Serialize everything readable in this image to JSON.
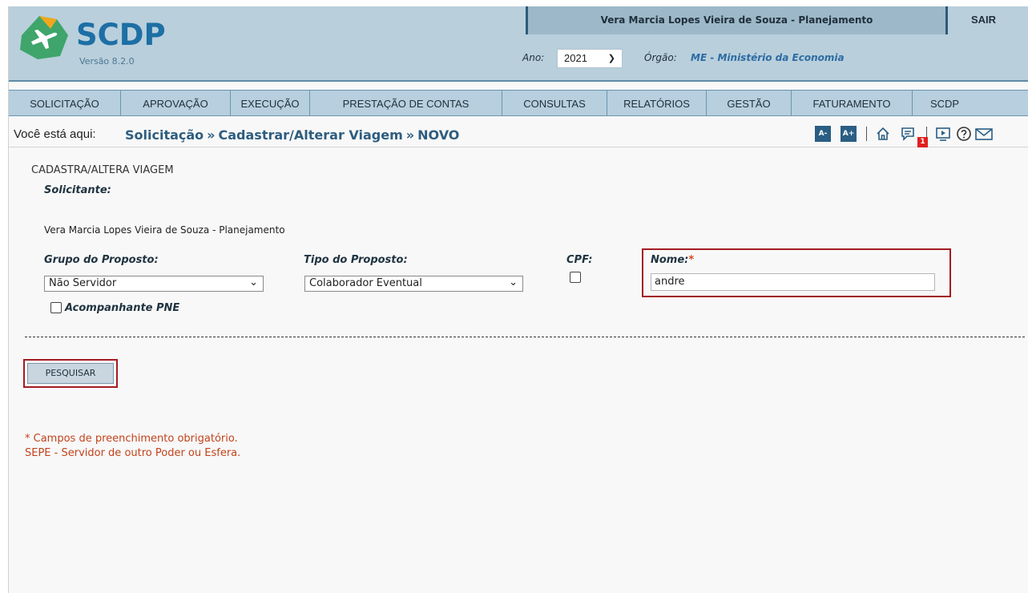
{
  "app": {
    "brand": "SCDP",
    "version": "Versão 8.2.0",
    "user": "Vera Marcia Lopes Vieira de Souza - Planejamento",
    "logout": "SAIR",
    "ano_label": "Ano:",
    "ano_value": "2021",
    "orgao_label": "Órgão:",
    "orgao_value": "ME - Ministério da Economia"
  },
  "menu": [
    {
      "label": "SOLICITAÇÃO"
    },
    {
      "label": "APROVAÇÃO"
    },
    {
      "label": "EXECUÇÃO"
    },
    {
      "label": "PRESTAÇÃO DE CONTAS"
    },
    {
      "label": "CONSULTAS"
    },
    {
      "label": "RELATÓRIOS"
    },
    {
      "label": "GESTÃO"
    },
    {
      "label": "FATURAMENTO"
    },
    {
      "label": "SCDP"
    }
  ],
  "breadcrumb": {
    "prefix": "Você está aqui:",
    "items": [
      "Solicitação",
      "Cadastrar/Alterar Viagem",
      "NOVO"
    ]
  },
  "toolbar": {
    "font_decrease": "A-",
    "font_increase": "A+",
    "messages_count": "1",
    "icons": [
      "home-icon",
      "messages-icon",
      "video-icon",
      "help-icon",
      "mail-icon"
    ]
  },
  "form": {
    "title": "CADASTRA/ALTERA VIAGEM",
    "solicitante_label": "Solicitante:",
    "solicitante_value": "Vera Marcia Lopes Vieira de Souza - Planejamento",
    "grupo_label": "Grupo do Proposto:",
    "grupo_value": "Não Servidor",
    "tipo_label": "Tipo do Proposto:",
    "tipo_value": "Colaborador Eventual",
    "cpf_label": "CPF:",
    "nome_label": "Nome:",
    "nome_required": "*",
    "nome_value": "andre",
    "acompanhante_label": "Acompanhante PNE",
    "search_button": "PESQUISAR"
  },
  "notes": {
    "required": "* Campos de preenchimento obrigatório.",
    "sepe": "SEPE - Servidor de outro Poder ou Esfera."
  },
  "colors": {
    "header_bg": "#b9cfdc",
    "accent": "#2e5d7f",
    "highlight_border": "#a31c22",
    "note_text": "#c2431c"
  }
}
